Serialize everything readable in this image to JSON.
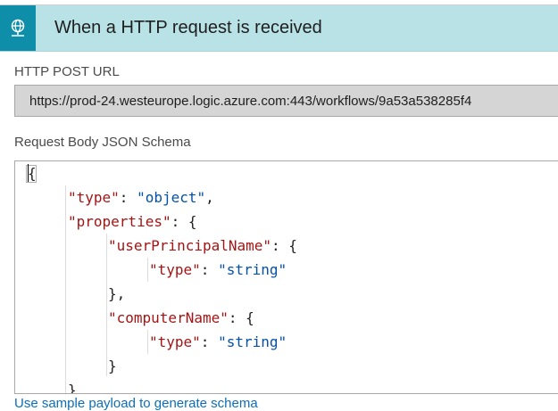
{
  "trigger": {
    "title": "When a HTTP request is received",
    "icon": "globe-network-icon",
    "accent_color": "#0e8ea8",
    "header_color": "#b9e2e6"
  },
  "post_url": {
    "label": "HTTP POST URL",
    "value": "https://prod-24.westeurope.logic.azure.com:443/workflows/9a53a538285f4"
  },
  "schema": {
    "label": "Request Body JSON Schema",
    "lines": [
      "{",
      "\"type\": \"object\",",
      "\"properties\": {",
      "\"userPrincipalName\": {",
      "\"type\": \"string\"",
      "},",
      "\"computerName\": {",
      "\"type\": \"string\"",
      "}",
      "}"
    ]
  },
  "footer_link": "Use sample payload to generate schema"
}
